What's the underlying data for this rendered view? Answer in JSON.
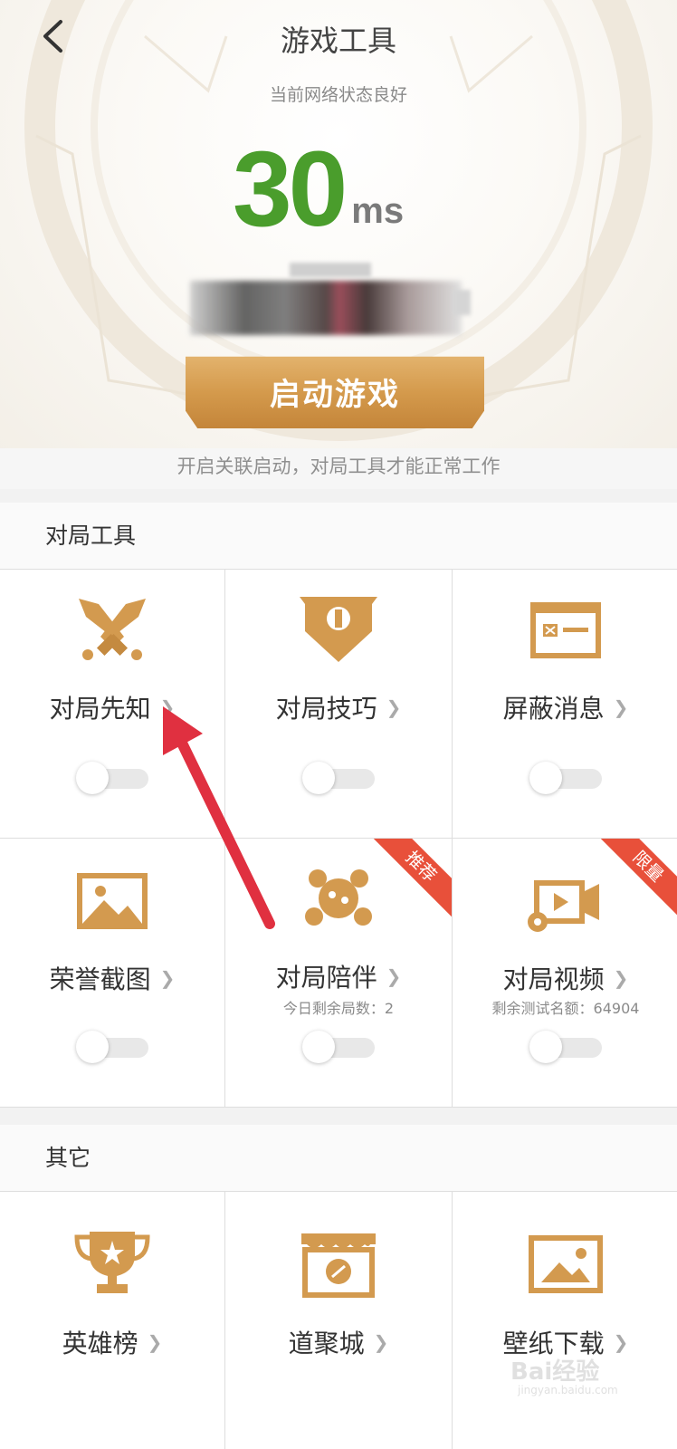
{
  "header": {
    "back_icon": "chevron-left-icon",
    "title": "游戏工具",
    "network_status": "当前网络状态良好",
    "latency_value": "30",
    "latency_unit": "ms"
  },
  "start_button": {
    "label": "启动游戏"
  },
  "hint": "开启关联启动，对局工具才能正常工作",
  "match_tools": {
    "title": "对局工具",
    "items": [
      {
        "label": "对局先知",
        "icon": "crossed-swords-icon",
        "toggle_on": false
      },
      {
        "label": "对局技巧",
        "icon": "banner-shield-icon",
        "toggle_on": false
      },
      {
        "label": "屏蔽消息",
        "icon": "message-card-icon",
        "toggle_on": false
      },
      {
        "label": "荣誉截图",
        "icon": "picture-icon",
        "toggle_on": false
      },
      {
        "label": "对局陪伴",
        "icon": "companion-icon",
        "toggle_on": false,
        "sub": "今日剩余局数：2",
        "ribbon": "推荐"
      },
      {
        "label": "对局视频",
        "icon": "video-camera-icon",
        "toggle_on": false,
        "sub": "剩余测试名额：64904",
        "ribbon": "限量"
      }
    ]
  },
  "other": {
    "title": "其它",
    "items": [
      {
        "label": "英雄榜",
        "icon": "trophy-icon"
      },
      {
        "label": "道聚城",
        "icon": "shop-icon"
      },
      {
        "label": "壁纸下载",
        "icon": "wallpaper-icon"
      }
    ]
  },
  "watermark": {
    "text": "Bai经验",
    "url": "jingyan.baidu.com"
  },
  "colors": {
    "accent_gold": "#d39a4f",
    "latency_green": "#4a9d2c",
    "ribbon_red": "#e8503a"
  }
}
